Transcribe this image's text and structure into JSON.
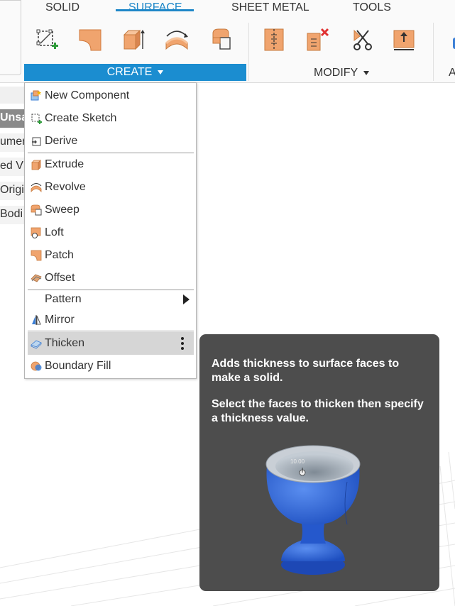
{
  "toolbar": {
    "tabs": [
      {
        "label": "SOLID",
        "active": false
      },
      {
        "label": "SURFACE",
        "active": true
      },
      {
        "label": "SHEET METAL",
        "active": false
      },
      {
        "label": "TOOLS",
        "active": false
      }
    ],
    "create_group": {
      "label": "CREATE"
    },
    "modify_group": {
      "label": "MODIFY"
    },
    "next_group_fragment": "A",
    "create_tools": [
      "create-sketch-icon",
      "patch-icon",
      "extrude-icon",
      "revolve-icon",
      "sweep-icon"
    ],
    "modify_tools": [
      "edit-face-icon",
      "delete-face-icon",
      "trim-icon",
      "extend-icon"
    ]
  },
  "browser": {
    "rows": [
      "Unsa",
      "umen",
      "ed V",
      "Origi",
      "Bodi"
    ]
  },
  "create_menu": {
    "items": [
      {
        "label": "New Component",
        "icon": "new-component-icon"
      },
      {
        "label": "Create Sketch",
        "icon": "create-sketch-icon"
      },
      {
        "label": "Derive",
        "icon": "derive-icon"
      },
      {
        "label": "Extrude",
        "icon": "extrude-icon"
      },
      {
        "label": "Revolve",
        "icon": "revolve-icon"
      },
      {
        "label": "Sweep",
        "icon": "sweep-icon"
      },
      {
        "label": "Loft",
        "icon": "loft-icon"
      },
      {
        "label": "Patch",
        "icon": "patch-icon"
      },
      {
        "label": "Offset",
        "icon": "offset-icon"
      },
      {
        "label": "Pattern",
        "icon": "",
        "submenu": true
      },
      {
        "label": "Mirror",
        "icon": "mirror-icon"
      },
      {
        "label": "Thicken",
        "icon": "thicken-icon",
        "highlighted": true
      },
      {
        "label": "Boundary Fill",
        "icon": "boundary-fill-icon"
      }
    ]
  },
  "tooltip": {
    "description": "Adds thickness to surface faces to make a solid.",
    "instruction": "Select the faces to thicken then specify a thickness value.",
    "illustration_value": "10.00"
  },
  "colors": {
    "accent": "#1b8dd0",
    "tool_orange": "#f0a46e",
    "tooltip_bg": "#4d4d4d",
    "menu_highlight": "#d6d6d6"
  }
}
